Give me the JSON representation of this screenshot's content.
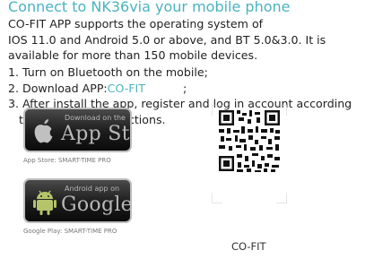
{
  "title": "Connect to NK36via your mobile phone",
  "intro": [
    "CO-FIT APP supports the operating system of",
    "IOS 11.0 and Android 5.0 or above, and BT 5.0&3.0. It is",
    "available for more than 150 mobile devices."
  ],
  "steps": {
    "step1": "1. Turn on Bluetooth on the mobile;",
    "step2_prefix": "2. Download APP:",
    "step2_app": "CO-FIT",
    "step2_suffix": ";",
    "step3_line1": "3. After install the app, register and log in account according",
    "step3_line2": "to a series of instructions."
  },
  "app_store": {
    "small_text": "Download on the",
    "big_text": "App Store",
    "caption": "App Store: SMART-TIME PRO",
    "icon": "apple-icon"
  },
  "google_play": {
    "small_text": "Android app on",
    "big_text": "Google Play",
    "caption": "Google Play: SMART-TIME PRO",
    "icon": "android-icon"
  },
  "qr": {
    "label": "CO-FIT"
  },
  "colors": {
    "accent": "#4ab3bf",
    "text": "#222222"
  }
}
